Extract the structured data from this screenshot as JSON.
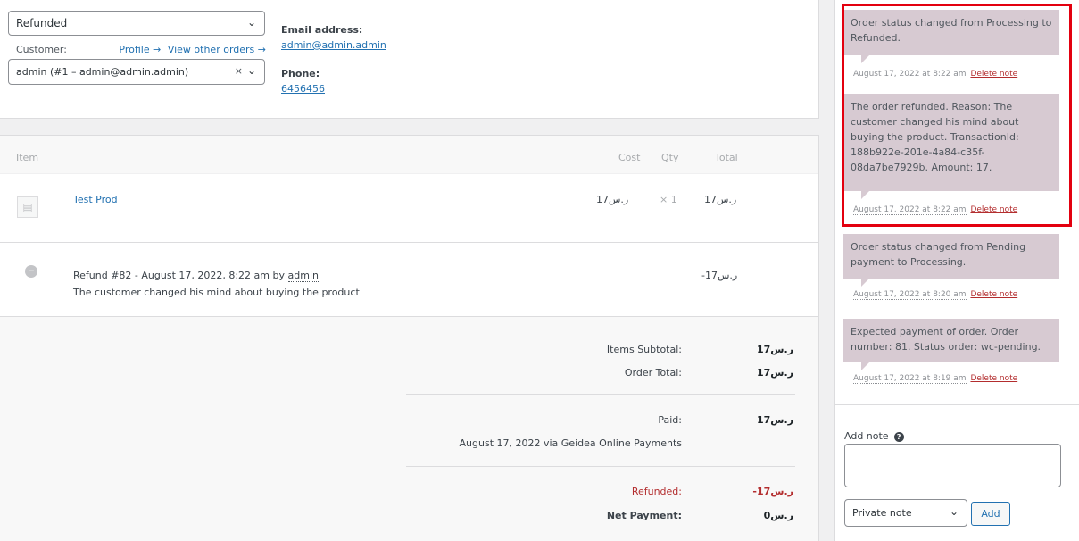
{
  "order": {
    "status_value": "Refunded",
    "customer_label": "Customer:",
    "profile_link": "Profile →",
    "view_orders_link": "View other orders →",
    "customer_value": "admin (#1 – admin@admin.admin)",
    "clear_symbol": "×",
    "email_label": "Email address:",
    "email_value": "admin@admin.admin",
    "phone_label": "Phone:",
    "phone_value": "6456456"
  },
  "items": {
    "headers": {
      "item": "Item",
      "cost": "Cost",
      "qty": "Qty",
      "total": "Total"
    },
    "rows": [
      {
        "name": "Test Prod",
        "cost": "17ر.س",
        "qty": "× 1",
        "total": "17ر.س"
      }
    ],
    "refund": {
      "line_prefix": "Refund #82 - August 17, 2022, 8:22 am by",
      "by_user": "admin",
      "reason": "The customer changed his mind about buying the product",
      "amount": "-17ر.س"
    }
  },
  "totals": {
    "items_subtotal_label": "Items Subtotal:",
    "items_subtotal_value": "17ر.س",
    "order_total_label": "Order Total:",
    "order_total_value": "17ر.س",
    "paid_label": "Paid:",
    "paid_value": "17ر.س",
    "paid_via": "August 17, 2022 via Geidea Online Payments",
    "refunded_label": "Refunded:",
    "refunded_value": "-17ر.س",
    "net_label": "Net Payment:",
    "net_value": "0ر.س"
  },
  "notes": [
    {
      "text": "Order status changed from Processing to Refunded.",
      "date": "August 17, 2022 at 8:22 am",
      "delete": "Delete note"
    },
    {
      "text": "The order refunded. Reason: The customer changed his mind about buying the product. TransactionId: 188b922e-201e-4a84-c35f-08da7be7929b. Amount: 17.",
      "date": "August 17, 2022 at 8:22 am",
      "delete": "Delete note"
    },
    {
      "text": "Order status changed from Pending payment to Processing.",
      "date": "August 17, 2022 at 8:20 am",
      "delete": "Delete note"
    },
    {
      "text": "Expected payment of order. Order number: 81. Status order: wc-pending.",
      "date": "August 17, 2022 at 8:19 am",
      "delete": "Delete note"
    }
  ],
  "add_note": {
    "label": "Add note",
    "note_type": "Private note",
    "add_button": "Add"
  },
  "colors": {
    "highlight": "#e3000f",
    "note_bg": "#d7cad2",
    "link": "#2271b1",
    "danger": "#b32d2e"
  }
}
